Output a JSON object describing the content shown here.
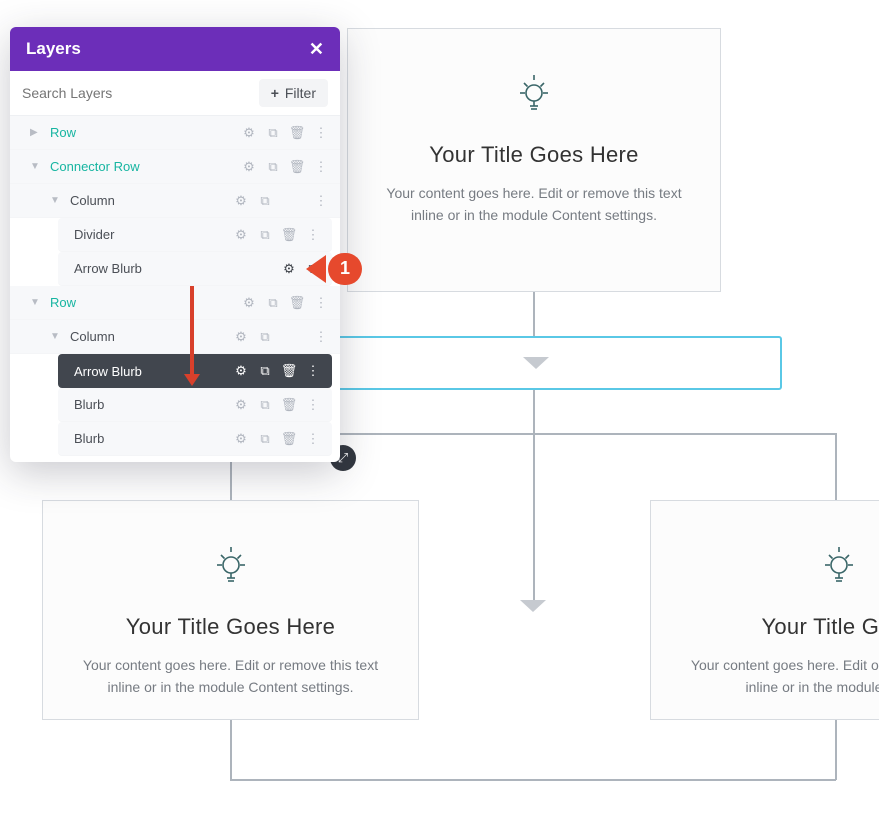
{
  "panel": {
    "title": "Layers",
    "search_placeholder": "Search Layers",
    "filter_label": "Filter"
  },
  "tree": {
    "row_top": "Row",
    "connector_row": "Connector Row",
    "column1": "Column",
    "divider": "Divider",
    "arrow_blurb": "Arrow Blurb",
    "row2": "Row",
    "column2": "Column",
    "arrow_blurb_active": "Arrow Blurb",
    "blurb1": "Blurb",
    "blurb2": "Blurb"
  },
  "callout": {
    "num": "1"
  },
  "card": {
    "title": "Your Title Goes Here",
    "body": "Your content goes here. Edit or remove this text inline or in the module Content settings."
  },
  "card_right": {
    "title": "Your Title Goes",
    "body": "Your content goes here. Edit or remove this text inline or in the module Conten"
  }
}
